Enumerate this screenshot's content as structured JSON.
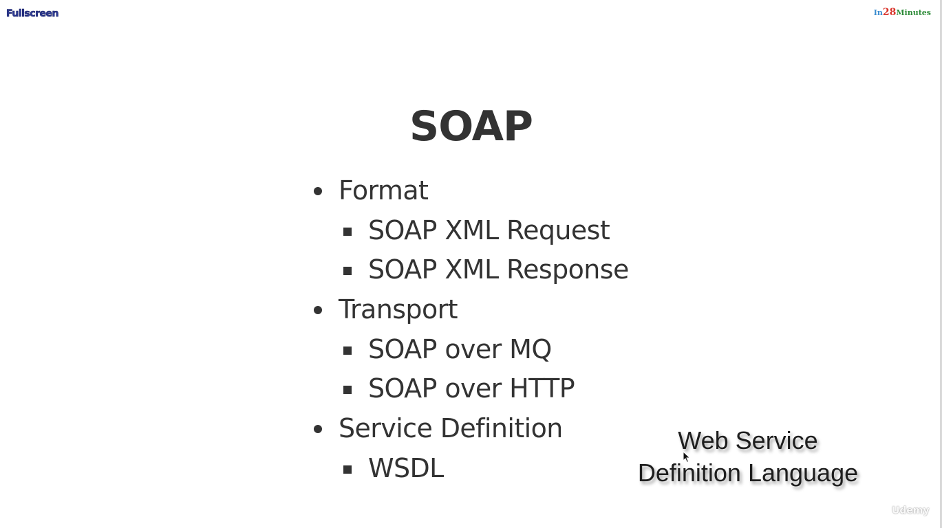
{
  "toolbar": {
    "fullscreen_label": "Fullscreen"
  },
  "brand": {
    "part1": "In",
    "part2": "28",
    "part3": "Minutes",
    "colors": {
      "in": "#3a8ccf",
      "number": "#d9342b",
      "minutes": "#2f8c3a"
    }
  },
  "slide": {
    "title": "SOAP",
    "items": [
      {
        "label": "Format",
        "children": [
          "SOAP XML Request",
          "SOAP XML Response"
        ]
      },
      {
        "label": "Transport",
        "children": [
          "SOAP over MQ",
          "SOAP over HTTP"
        ]
      },
      {
        "label": "Service Definition",
        "children": [
          "WSDL"
        ]
      }
    ]
  },
  "annotation": {
    "line1": "Web Service",
    "line2": "Definition Language"
  },
  "watermark": {
    "icon": "udemy-logo-icon",
    "text": "Udemy"
  }
}
